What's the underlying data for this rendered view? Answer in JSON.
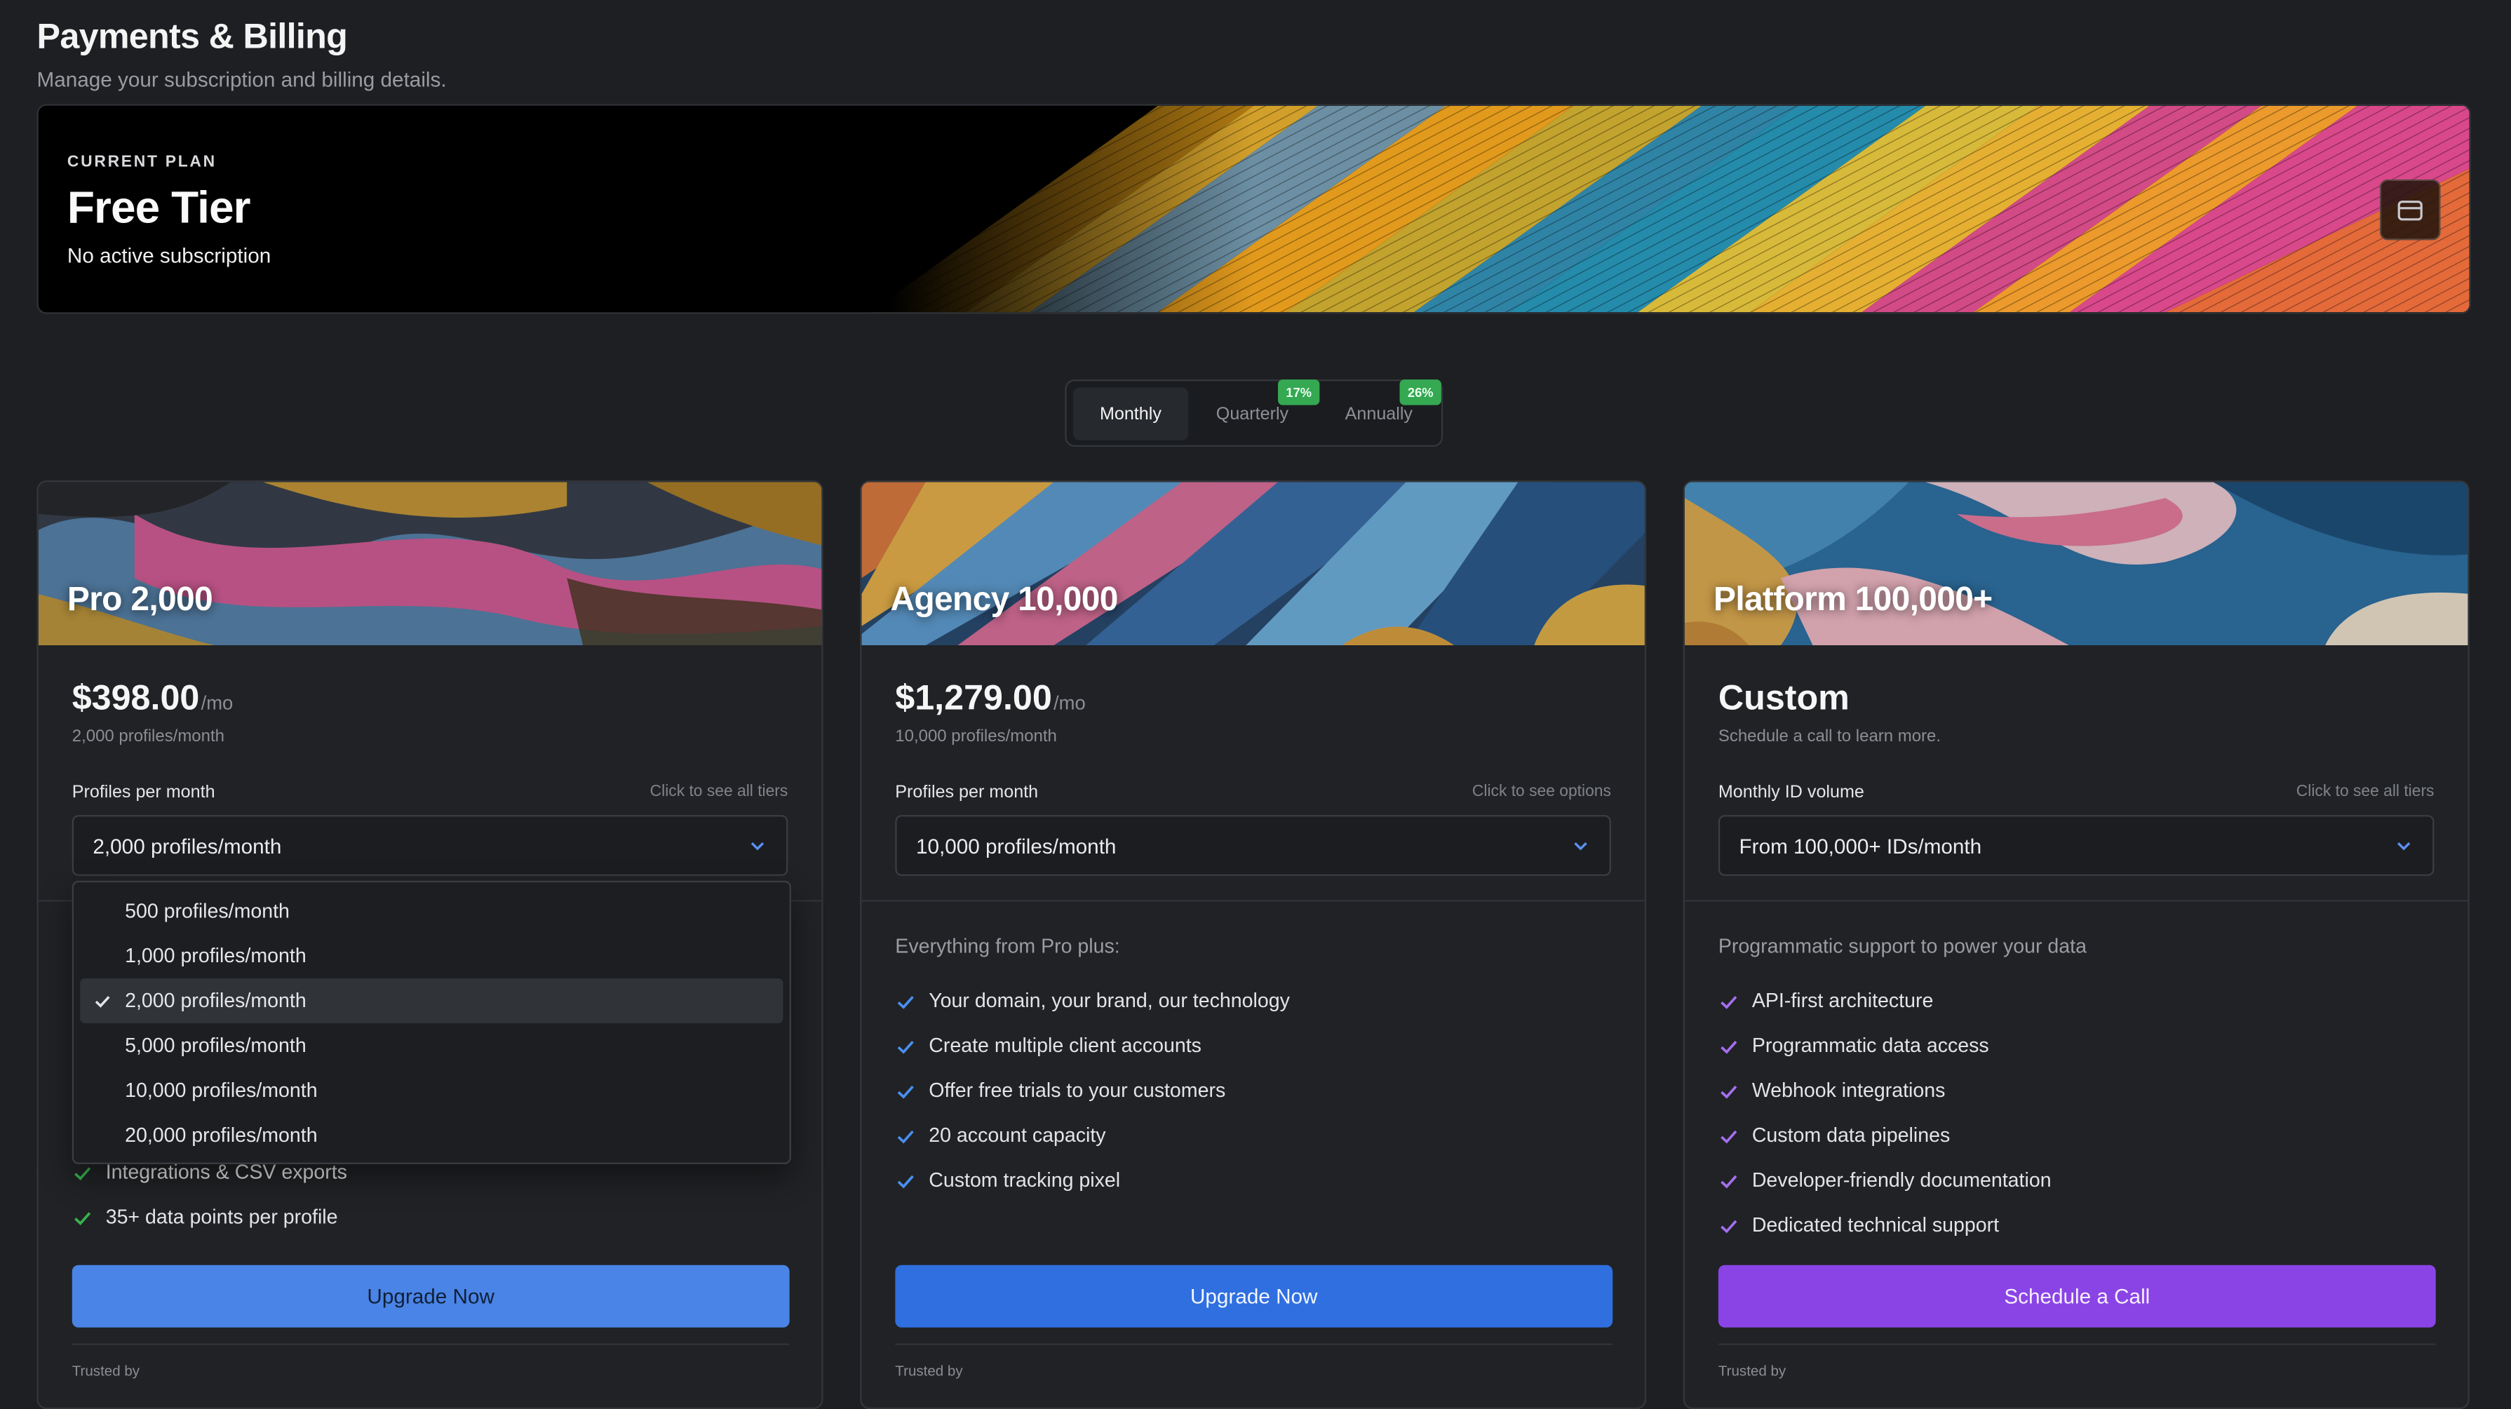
{
  "page": {
    "title": "Payments & Billing",
    "subtitle": "Manage your subscription and billing details."
  },
  "current_plan": {
    "eyebrow": "CURRENT PLAN",
    "name": "Free Tier",
    "status": "No active subscription",
    "card_icon": "credit-card-icon"
  },
  "billing_toggle": {
    "options": [
      {
        "label": "Monthly",
        "badge": "",
        "active": true
      },
      {
        "label": "Quarterly",
        "badge": "17%",
        "active": false
      },
      {
        "label": "Annually",
        "badge": "26%",
        "active": false
      }
    ],
    "badge_color": "#35a852"
  },
  "plans": [
    {
      "name": "Pro 2,000",
      "price": "$398.00",
      "period": "/mo",
      "price_sub": "2,000 profiles/month",
      "field_label": "Profiles per month",
      "field_hint": "Click to see all tiers",
      "selected": "2,000 profiles/month",
      "features_visible": [
        "Integrations & CSV exports",
        "35+ data points per profile"
      ],
      "cta": "Upgrade Now",
      "cta_color": "#4a84e6",
      "check_color": "#37b24d",
      "trusted": "Trusted by"
    },
    {
      "name": "Agency 10,000",
      "price": "$1,279.00",
      "period": "/mo",
      "price_sub": "10,000 profiles/month",
      "field_label": "Profiles per month",
      "field_hint": "Click to see options",
      "selected": "10,000 profiles/month",
      "features_intro": "Everything from Pro plus:",
      "features": [
        "Your domain, your brand, our technology",
        "Create multiple client accounts",
        "Offer free trials to your customers",
        "20 account capacity",
        "Custom tracking pixel"
      ],
      "cta": "Upgrade Now",
      "cta_color": "#2f6fe0",
      "check_color": "#4a8ff0",
      "trusted": "Trusted by"
    },
    {
      "name": "Platform 100,000+",
      "price": "Custom",
      "price_sub": "Schedule a call to learn more.",
      "field_label": "Monthly ID volume",
      "field_hint": "Click to see all tiers",
      "selected": "From 100,000+ IDs/month",
      "features_intro": "Programmatic support to power your data",
      "features": [
        "API-first architecture",
        "Programmatic data access",
        "Webhook integrations",
        "Custom data pipelines",
        "Developer-friendly documentation",
        "Dedicated technical support"
      ],
      "cta": "Schedule a Call",
      "cta_color": "#8a44e6",
      "check_color": "#a66ff0",
      "trusted": "Trusted by"
    }
  ],
  "dropdown": {
    "options": [
      "500 profiles/month",
      "1,000 profiles/month",
      "2,000 profiles/month",
      "5,000 profiles/month",
      "10,000 profiles/month",
      "20,000 profiles/month"
    ],
    "selected_index": 2,
    "check_icon": "check-icon"
  }
}
